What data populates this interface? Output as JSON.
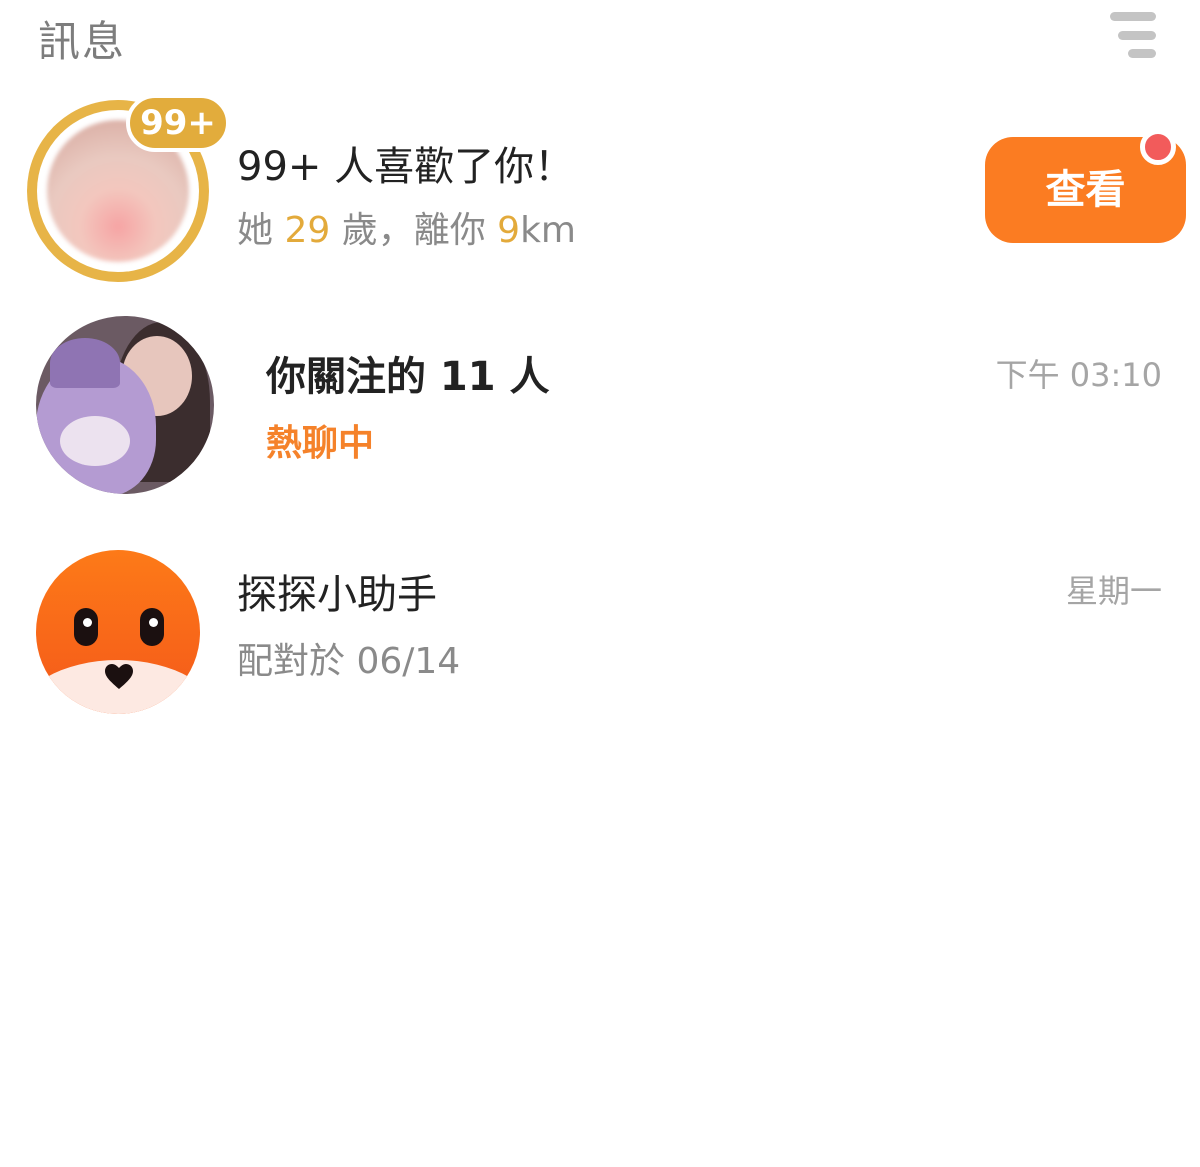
{
  "header": {
    "title": "訊息",
    "menu_icon": "menu-lines-icon"
  },
  "likes": {
    "badge": "99+",
    "title": "99+ 人喜歡了你！",
    "sub_prefix": "她 ",
    "age": "29",
    "sub_middle": " 歲，離你 ",
    "distance": "9",
    "sub_unit": "km",
    "button_label": "查看",
    "accent_color": "#e3aa3b",
    "button_color": "#fb7c22",
    "dot_color": "#f25b5b"
  },
  "conversations": [
    {
      "title": "你關注的 11 人",
      "subtitle": "熱聊中",
      "time": "下午 03:10",
      "subtitle_color": "#f5822a"
    },
    {
      "title": "探探小助手",
      "subtitle": "配對於 06/14",
      "time": "星期一"
    }
  ]
}
